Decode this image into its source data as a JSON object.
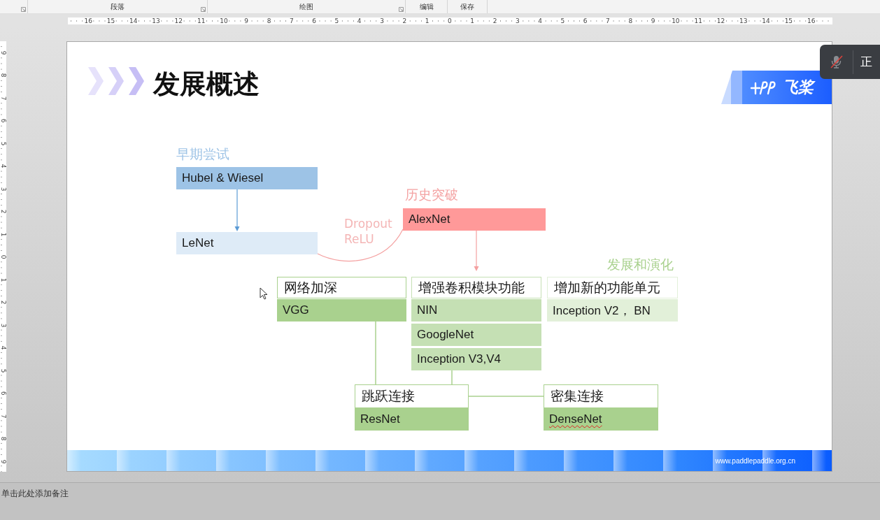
{
  "ribbon": {
    "groups": [
      {
        "launcher": true
      },
      {
        "label": "段落",
        "launcher": true
      },
      {
        "label": "绘图",
        "launcher": true
      },
      {
        "label": "编辑",
        "launcher": false
      },
      {
        "label": "保存",
        "launcher": false
      }
    ]
  },
  "horizontal_ruler": {
    "labels": [
      "16",
      "15",
      "14",
      "13",
      "12",
      "11",
      "10",
      "9",
      "8",
      "7",
      "6",
      "5",
      "4",
      "3",
      "2",
      "1",
      "0",
      "1",
      "2",
      "3",
      "4",
      "5",
      "6",
      "7",
      "8",
      "9",
      "10",
      "11",
      "12",
      "13",
      "14",
      "15",
      "16"
    ]
  },
  "vertical_ruler": {
    "labels": [
      "9",
      "8",
      "7",
      "6",
      "5",
      "4",
      "3",
      "2",
      "1",
      "0",
      "1",
      "2",
      "3",
      "4",
      "5",
      "6",
      "7",
      "8",
      "9"
    ]
  },
  "slide": {
    "title": "发展概述",
    "logo_text": "飞桨",
    "footer_url": "www.paddlepaddle.org.cn",
    "nodes": [
      {
        "kind": "caption",
        "text": "早期尝试",
        "color": "#9dc3e6"
      },
      {
        "kind": "box",
        "text": "Hubel & Wiesel",
        "color": "#9dc3e6"
      },
      {
        "kind": "box",
        "text": "LeNet",
        "color": "#deebf7"
      },
      {
        "kind": "caption",
        "text": "历史突破",
        "color": "#f4a3a3"
      },
      {
        "kind": "note",
        "text": "Dropout\nReLU",
        "color": "#f4b6b6"
      },
      {
        "kind": "box",
        "text": "AlexNet",
        "color": "#ff9999"
      },
      {
        "kind": "caption",
        "text": "发展和演化",
        "color": "#a9d18e"
      },
      {
        "kind": "header",
        "text": "网络加深",
        "color": "#a9d18e"
      },
      {
        "kind": "box",
        "text": "VGG",
        "color": "#a9d18e"
      },
      {
        "kind": "header",
        "text": "增强卷积模块功能",
        "color": "#c5e0b4"
      },
      {
        "kind": "box",
        "text": "NIN",
        "color": "#c5e0b4"
      },
      {
        "kind": "box",
        "text": "GoogleNet",
        "color": "#c5e0b4"
      },
      {
        "kind": "box",
        "text": "Inception V3,V4",
        "color": "#c5e0b4"
      },
      {
        "kind": "header",
        "text": "增加新的功能单元",
        "color": "#e2f0d9"
      },
      {
        "kind": "box",
        "text": "Inception V2， BN",
        "color": "#e2f0d9"
      },
      {
        "kind": "header",
        "text": "跳跃连接",
        "color": "#a9d18e"
      },
      {
        "kind": "box",
        "text": "ResNet",
        "color": "#a9d18e"
      },
      {
        "kind": "header",
        "text": "密集连接",
        "color": "#a9d18e"
      },
      {
        "kind": "box",
        "text": "DenseNet",
        "color": "#a9d18e",
        "spell_error": true
      }
    ]
  },
  "notes": {
    "placeholder": "单击此处添加备注"
  },
  "meeting_bar": {
    "mic_muted": true,
    "status": "正"
  }
}
